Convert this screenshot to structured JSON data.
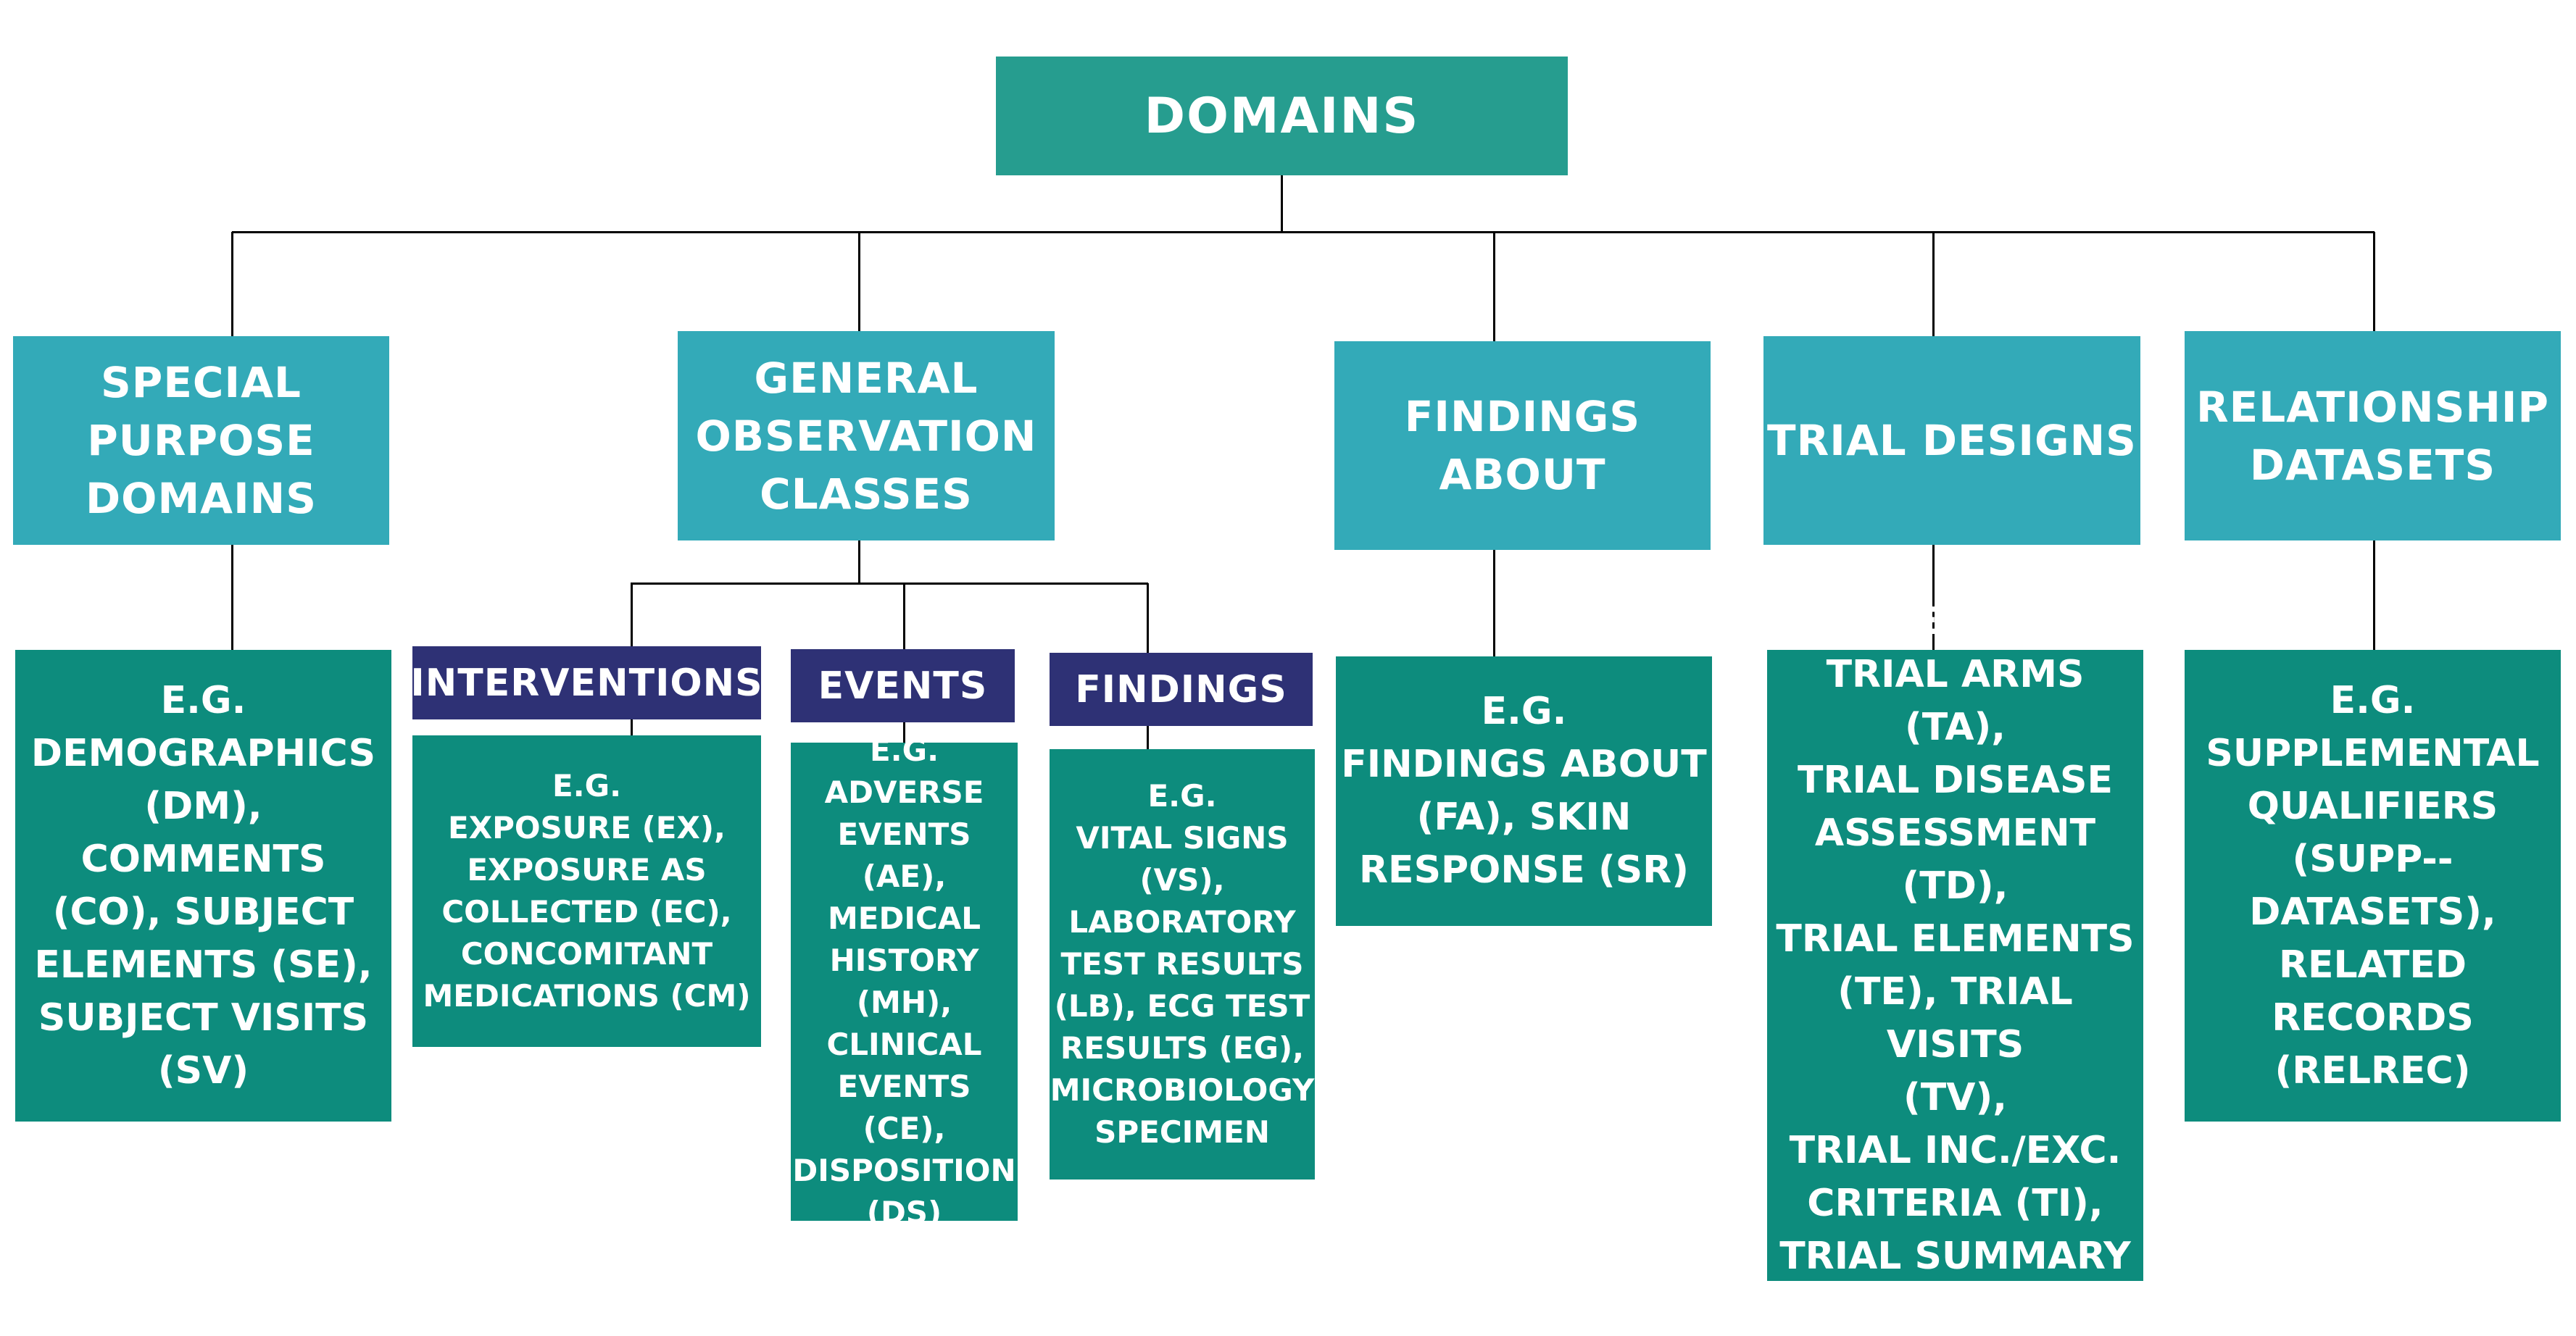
{
  "root": {
    "label": "DOMAINS"
  },
  "categories": [
    {
      "label": "SPECIAL\nPURPOSE\nDOMAINS",
      "example": "E.G.\nDEMOGRAPHICS\n(DM),\nCOMMENTS\n(CO), SUBJECT\nELEMENTS (SE),\nSUBJECT VISITS\n(SV)"
    },
    {
      "label": "GENERAL\nOBSERVATION\nCLASSES",
      "subclasses": [
        {
          "label": "INTERVENTIONS",
          "example": "E.G.\nEXPOSURE (EX),\nEXPOSURE AS\nCOLLECTED (EC),\nCONCOMITANT\nMEDICATIONS (CM)"
        },
        {
          "label": "EVENTS",
          "example": "E.G.\nADVERSE\nEVENTS (AE),\nMEDICAL\nHISTORY\n(MH),\nCLINICAL\nEVENTS (CE),\nDISPOSITION\n(DS)"
        },
        {
          "label": "FINDINGS",
          "example": "E.G.\nVITAL SIGNS\n(VS),\nLABORATORY\nTEST RESULTS\n(LB), ECG TEST\nRESULTS (EG),\nMICROBIOLOGY\nSPECIMEN"
        }
      ]
    },
    {
      "label": "FINDINGS\nABOUT",
      "example": "E.G.\nFINDINGS ABOUT\n(FA), SKIN\nRESPONSE (SR)"
    },
    {
      "label": "TRIAL DESIGNS",
      "example": "E.G.\nTRIAL ARMS (TA),\nTRIAL DISEASE\nASSESSMENT (TD),\nTRIAL ELEMENTS\n(TE), TRIAL VISITS\n(TV),\nTRIAL INC./EXC.\nCRITERIA (TI),\nTRIAL SUMMARY\n(TS)"
    },
    {
      "label": "RELATIONSHIP\nDATASETS",
      "example": "E.G.\nSUPPLEMENTAL\nQUALIFIERS\n(SUPP--\nDATASETS),\nRELATED\nRECORDS\n(RELREC)"
    }
  ],
  "colors": {
    "root": "#269d8f",
    "category": "#33aab8",
    "subclass": "#2e3175",
    "example": "#0d8c7d",
    "connector": "#000000"
  }
}
